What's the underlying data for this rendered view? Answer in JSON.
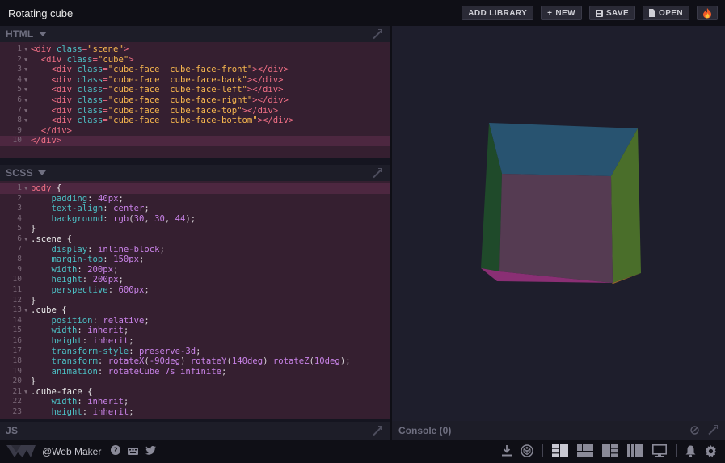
{
  "app": {
    "title": "Rotating cube",
    "buttons": {
      "add_library": "ADD LIBRARY",
      "new": "NEW",
      "save": "SAVE",
      "open": "OPEN"
    }
  },
  "panels": {
    "html": {
      "title": "HTML"
    },
    "scss": {
      "title": "SCSS"
    },
    "js": {
      "title": "JS"
    },
    "console": {
      "title": "Console (0)"
    }
  },
  "html_code": [
    {
      "n": "1",
      "fold": true,
      "t": [
        [
          "c-tag",
          "<div "
        ],
        [
          "c-attr",
          "class"
        ],
        [
          "c-tag",
          "="
        ],
        [
          "c-str",
          "\"scene\""
        ],
        [
          "c-tag",
          ">"
        ]
      ]
    },
    {
      "n": "2",
      "fold": true,
      "t": [
        [
          "txt",
          "  "
        ],
        [
          "c-tag",
          "<div "
        ],
        [
          "c-attr",
          "class"
        ],
        [
          "c-tag",
          "="
        ],
        [
          "c-str",
          "\"cube\""
        ],
        [
          "c-tag",
          ">"
        ]
      ]
    },
    {
      "n": "3",
      "fold": true,
      "t": [
        [
          "txt",
          "    "
        ],
        [
          "c-tag",
          "<div "
        ],
        [
          "c-attr",
          "class"
        ],
        [
          "c-tag",
          "="
        ],
        [
          "c-str",
          "\"cube-face  cube-face-front\""
        ],
        [
          "c-tag",
          "></div>"
        ]
      ]
    },
    {
      "n": "4",
      "fold": true,
      "t": [
        [
          "txt",
          "    "
        ],
        [
          "c-tag",
          "<div "
        ],
        [
          "c-attr",
          "class"
        ],
        [
          "c-tag",
          "="
        ],
        [
          "c-str",
          "\"cube-face  cube-face-back\""
        ],
        [
          "c-tag",
          "></div>"
        ]
      ]
    },
    {
      "n": "5",
      "fold": true,
      "t": [
        [
          "txt",
          "    "
        ],
        [
          "c-tag",
          "<div "
        ],
        [
          "c-attr",
          "class"
        ],
        [
          "c-tag",
          "="
        ],
        [
          "c-str",
          "\"cube-face  cube-face-left\""
        ],
        [
          "c-tag",
          "></div>"
        ]
      ]
    },
    {
      "n": "6",
      "fold": true,
      "t": [
        [
          "txt",
          "    "
        ],
        [
          "c-tag",
          "<div "
        ],
        [
          "c-attr",
          "class"
        ],
        [
          "c-tag",
          "="
        ],
        [
          "c-str",
          "\"cube-face  cube-face-right\""
        ],
        [
          "c-tag",
          "></div>"
        ]
      ]
    },
    {
      "n": "7",
      "fold": true,
      "t": [
        [
          "txt",
          "    "
        ],
        [
          "c-tag",
          "<div "
        ],
        [
          "c-attr",
          "class"
        ],
        [
          "c-tag",
          "="
        ],
        [
          "c-str",
          "\"cube-face  cube-face-top\""
        ],
        [
          "c-tag",
          "></div>"
        ]
      ]
    },
    {
      "n": "8",
      "fold": true,
      "t": [
        [
          "txt",
          "    "
        ],
        [
          "c-tag",
          "<div "
        ],
        [
          "c-attr",
          "class"
        ],
        [
          "c-tag",
          "="
        ],
        [
          "c-str",
          "\"cube-face  cube-face-bottom\""
        ],
        [
          "c-tag",
          "></div>"
        ]
      ]
    },
    {
      "n": "9",
      "fold": false,
      "t": [
        [
          "txt",
          "  "
        ],
        [
          "c-tag",
          "</div>"
        ]
      ]
    },
    {
      "n": "10",
      "fold": false,
      "hl": true,
      "t": [
        [
          "c-tag",
          "</div>"
        ]
      ]
    }
  ],
  "scss_code": [
    {
      "n": "1",
      "fold": true,
      "hl": true,
      "t": [
        [
          "c-sel-hl",
          "body"
        ],
        [
          "c-sel",
          " {"
        ]
      ]
    },
    {
      "n": "2",
      "t": [
        [
          "txt",
          "    "
        ],
        [
          "c-prop",
          "padding"
        ],
        [
          "txt",
          ": "
        ],
        [
          "c-num",
          "40px"
        ],
        [
          "txt",
          ";"
        ]
      ]
    },
    {
      "n": "3",
      "t": [
        [
          "txt",
          "    "
        ],
        [
          "c-prop",
          "text-align"
        ],
        [
          "txt",
          ": "
        ],
        [
          "c-val",
          "center"
        ],
        [
          "txt",
          ";"
        ]
      ]
    },
    {
      "n": "4",
      "t": [
        [
          "txt",
          "    "
        ],
        [
          "c-prop",
          "background"
        ],
        [
          "txt",
          ": "
        ],
        [
          "c-val",
          "rgb"
        ],
        [
          "txt",
          "("
        ],
        [
          "c-num",
          "30"
        ],
        [
          "txt",
          ", "
        ],
        [
          "c-num",
          "30"
        ],
        [
          "txt",
          ", "
        ],
        [
          "c-num",
          "44"
        ],
        [
          "txt",
          ");"
        ]
      ]
    },
    {
      "n": "5",
      "t": [
        [
          "c-sel",
          "}"
        ]
      ]
    },
    {
      "n": "6",
      "fold": true,
      "t": [
        [
          "c-sel",
          ".scene {"
        ]
      ]
    },
    {
      "n": "7",
      "t": [
        [
          "txt",
          "    "
        ],
        [
          "c-prop",
          "display"
        ],
        [
          "txt",
          ": "
        ],
        [
          "c-val",
          "inline-block"
        ],
        [
          "txt",
          ";"
        ]
      ]
    },
    {
      "n": "8",
      "t": [
        [
          "txt",
          "    "
        ],
        [
          "c-prop",
          "margin-top"
        ],
        [
          "txt",
          ": "
        ],
        [
          "c-num",
          "150px"
        ],
        [
          "txt",
          ";"
        ]
      ]
    },
    {
      "n": "9",
      "t": [
        [
          "txt",
          "    "
        ],
        [
          "c-prop",
          "width"
        ],
        [
          "txt",
          ": "
        ],
        [
          "c-num",
          "200px"
        ],
        [
          "txt",
          ";"
        ]
      ]
    },
    {
      "n": "10",
      "t": [
        [
          "txt",
          "    "
        ],
        [
          "c-prop",
          "height"
        ],
        [
          "txt",
          ": "
        ],
        [
          "c-num",
          "200px"
        ],
        [
          "txt",
          ";"
        ]
      ]
    },
    {
      "n": "11",
      "t": [
        [
          "txt",
          "    "
        ],
        [
          "c-prop",
          "perspective"
        ],
        [
          "txt",
          ": "
        ],
        [
          "c-num",
          "600px"
        ],
        [
          "txt",
          ";"
        ]
      ]
    },
    {
      "n": "12",
      "t": [
        [
          "c-sel",
          "}"
        ]
      ]
    },
    {
      "n": "13",
      "fold": true,
      "t": [
        [
          "c-sel",
          ".cube {"
        ]
      ]
    },
    {
      "n": "14",
      "t": [
        [
          "txt",
          "    "
        ],
        [
          "c-prop",
          "position"
        ],
        [
          "txt",
          ": "
        ],
        [
          "c-val",
          "relative"
        ],
        [
          "txt",
          ";"
        ]
      ]
    },
    {
      "n": "15",
      "t": [
        [
          "txt",
          "    "
        ],
        [
          "c-prop",
          "width"
        ],
        [
          "txt",
          ": "
        ],
        [
          "c-val",
          "inherit"
        ],
        [
          "txt",
          ";"
        ]
      ]
    },
    {
      "n": "16",
      "t": [
        [
          "txt",
          "    "
        ],
        [
          "c-prop",
          "height"
        ],
        [
          "txt",
          ": "
        ],
        [
          "c-val",
          "inherit"
        ],
        [
          "txt",
          ";"
        ]
      ]
    },
    {
      "n": "17",
      "t": [
        [
          "txt",
          "    "
        ],
        [
          "c-prop",
          "transform-style"
        ],
        [
          "txt",
          ": "
        ],
        [
          "c-val",
          "preserve-3d"
        ],
        [
          "txt",
          ";"
        ]
      ]
    },
    {
      "n": "18",
      "t": [
        [
          "txt",
          "    "
        ],
        [
          "c-prop",
          "transform"
        ],
        [
          "txt",
          ": "
        ],
        [
          "c-val",
          "rotateX"
        ],
        [
          "txt",
          "("
        ],
        [
          "c-num",
          "-90deg"
        ],
        [
          "txt",
          ") "
        ],
        [
          "c-val",
          "rotateY"
        ],
        [
          "txt",
          "("
        ],
        [
          "c-num",
          "140deg"
        ],
        [
          "txt",
          ") "
        ],
        [
          "c-val",
          "rotateZ"
        ],
        [
          "txt",
          "("
        ],
        [
          "c-num",
          "10deg"
        ],
        [
          "txt",
          ");"
        ]
      ]
    },
    {
      "n": "19",
      "t": [
        [
          "txt",
          "    "
        ],
        [
          "c-prop",
          "animation"
        ],
        [
          "txt",
          ": "
        ],
        [
          "c-val",
          "rotateCube"
        ],
        [
          "txt",
          " "
        ],
        [
          "c-num",
          "7s"
        ],
        [
          "txt",
          " "
        ],
        [
          "c-val",
          "infinite"
        ],
        [
          "txt",
          ";"
        ]
      ]
    },
    {
      "n": "20",
      "t": [
        [
          "c-sel",
          "}"
        ]
      ]
    },
    {
      "n": "21",
      "fold": true,
      "t": [
        [
          "c-sel",
          ".cube-face {"
        ]
      ]
    },
    {
      "n": "22",
      "t": [
        [
          "txt",
          "    "
        ],
        [
          "c-prop",
          "width"
        ],
        [
          "txt",
          ": "
        ],
        [
          "c-val",
          "inherit"
        ],
        [
          "txt",
          ";"
        ]
      ]
    },
    {
      "n": "23",
      "t": [
        [
          "txt",
          "    "
        ],
        [
          "c-prop",
          "height"
        ],
        [
          "txt",
          ": "
        ],
        [
          "c-val",
          "inherit"
        ],
        [
          "txt",
          ";"
        ]
      ]
    }
  ],
  "footer": {
    "brand": "@Web Maker"
  },
  "colors": {
    "cube_top": "#285370",
    "cube_front": "#553b52",
    "cube_right": "#4a6e2a",
    "cube_left": "#1f4a2a",
    "cube_bottom": "#8a2f74"
  }
}
